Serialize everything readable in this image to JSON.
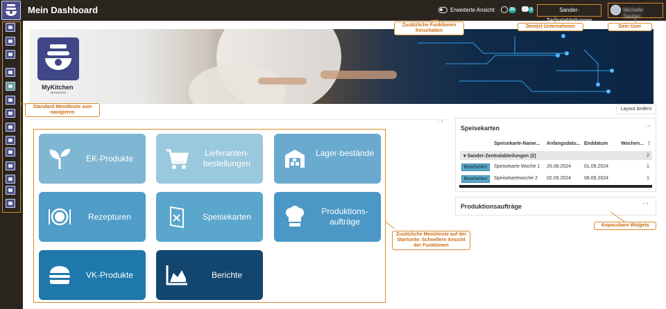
{
  "header": {
    "app_title": "Mein Dashboard",
    "extended_view_label": "Erweiterte Ansicht",
    "clock_badge": "28",
    "chat_badge": "2",
    "company": "Sander-Zentralabteilungen",
    "user_name": "Michelle Sauber"
  },
  "sidebar": {
    "items": [
      "home",
      "dashboard",
      "grid",
      "menu",
      "inventory",
      "plants",
      "storage",
      "kitchen",
      "tools",
      "settings",
      "documents",
      "charts",
      "food",
      "buildings",
      "images"
    ]
  },
  "banner": {
    "brand": "MyKitchen",
    "brand_sub": "MANAGER"
  },
  "layout_button": "Layout ändern",
  "tiles": [
    {
      "label": "EK-Produkte",
      "icon": "sprout-icon",
      "color": "#7fb6d3"
    },
    {
      "label": "Lieferanten-bestellungen",
      "icon": "cart-icon",
      "color": "#9ac8dc"
    },
    {
      "label": "Lager-bestände",
      "icon": "warehouse-icon",
      "color": "#6aaacf"
    },
    {
      "label": "Rezepturen",
      "icon": "plate-icon",
      "color": "#4e9cc7"
    },
    {
      "label": "Speisekarten",
      "icon": "menu-card-icon",
      "color": "#5aa6cd"
    },
    {
      "label": "Produktions-aufträge",
      "icon": "chef-hat-icon",
      "color": "#4b98c6"
    },
    {
      "label": "VK-Produkte",
      "icon": "burger-icon",
      "color": "#1f78ab"
    },
    {
      "label": "Berichte",
      "icon": "area-chart-icon",
      "color": "#12466f"
    }
  ],
  "speisekarten": {
    "title": "Speisekarten",
    "columns": [
      "Speisekarte-Name...",
      "Anfangsdatu...",
      "Enddatum",
      "Wochen..."
    ],
    "group": "Sander-Zentralabteilungen (2)",
    "group_count": "2",
    "edit_label": "Bearbeiten",
    "rows": [
      {
        "name": "Speisekarte Woche 1",
        "start": "26.08.2024",
        "end": "01.09.2024",
        "week": "1"
      },
      {
        "name": "Speisekartewoche 2",
        "start": "02.09.2024",
        "end": "08.09.2024",
        "week": "1"
      }
    ]
  },
  "produktionsauftraege": {
    "title": "Produktionsaufträge"
  },
  "callouts": {
    "features": "Zusätzliche Funktionen freischalten",
    "company": "Dein(e) Unternehmen",
    "user": "Dein User",
    "menu": "Standard Menüleiste zum navigieren",
    "tiles": "Zusätzliche Menüleiste auf der Startseite. Schnellere Ansicht der Funktionen",
    "widgets": "Anpassbare Widgets"
  },
  "colors": {
    "topbar": "#2b2520",
    "callout_border": "#d98a2b",
    "callout_text": "#cc6d12",
    "brand": "#3f4787"
  }
}
